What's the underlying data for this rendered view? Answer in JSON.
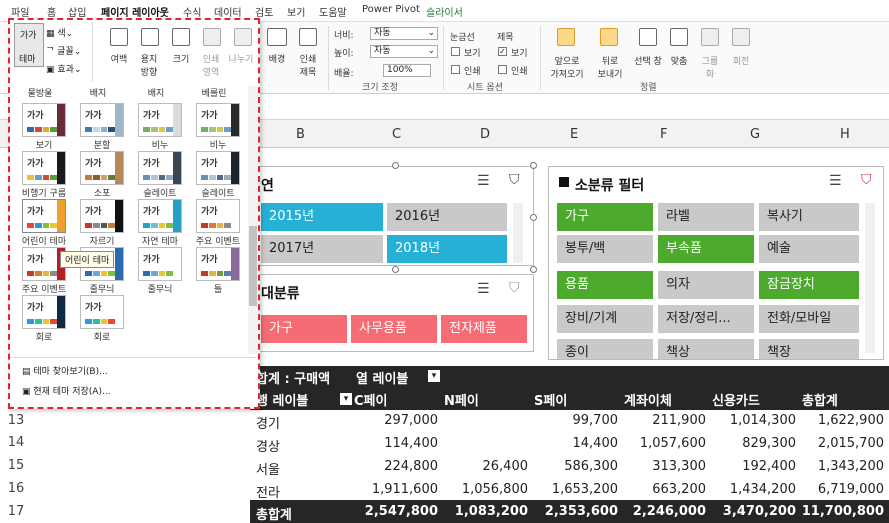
{
  "menu": [
    "파일",
    "홈",
    "삽입",
    "페이지 레이아웃",
    "수식",
    "데이터",
    "검토",
    "보기",
    "도움말",
    "Power Pivot",
    "슬라이서"
  ],
  "ribbon": {
    "theme_label": "테마",
    "colors_label": "색",
    "fonts_label": "글꼴",
    "effects_label": "효과",
    "margins_label": "여백",
    "orientation_label": "용지\n방향",
    "size_label": "크기",
    "print_area_label": "인쇄\n영역",
    "breaks_label": "나누기",
    "background_label": "배경",
    "print_titles_label": "인쇄\n제목",
    "width_label": "너비:",
    "width_value": "자동",
    "height_label": "높이:",
    "height_value": "자동",
    "scale_label": "배율:",
    "scale_value": "100%",
    "scale_group": "크기 조정",
    "gridlines_label": "눈금선",
    "headings_label": "제목",
    "view_label": "보기",
    "print_label": "인쇄",
    "sheet_options_group": "시트 옵션",
    "bring_forward": "앞으로\n가져오기",
    "send_backward": "뒤로\n보내기",
    "selection_pane": "선택 창",
    "align": "맞춤",
    "group": "그룹\n화",
    "rotate": "회전",
    "arrange_group": "정렬"
  },
  "gallery": {
    "row0_labels": [
      "물방울",
      "배지",
      "배지",
      "베를린"
    ],
    "themes": [
      {
        "label": "보기",
        "side": "#6b2b3a",
        "bars": [
          "#2e6aa8",
          "#d04a36",
          "#e8a92b",
          "#5c9b3b"
        ]
      },
      {
        "label": "분할",
        "side": "#9db7c9",
        "bars": [
          "#3f7ab4",
          "#c5d8e6",
          "#8fb0c4",
          "#2c4e6e"
        ]
      },
      {
        "label": "비누",
        "side": "#dcdcdc",
        "bars": [
          "#79a96b",
          "#a5c96a",
          "#d8c74f",
          "#6c9ec7"
        ]
      },
      {
        "label": "비누",
        "side": "#2b2b2b",
        "bars": [
          "#79a96b",
          "#a5c96a",
          "#d8c74f",
          "#6c9ec7"
        ]
      },
      {
        "label": "비행기 구름",
        "side": "#1a1a1a",
        "bars": [
          "#e9c23b",
          "#6c9ec7",
          "#d04a36",
          "#5c9b3b"
        ]
      },
      {
        "label": "소포",
        "side": "#b58a5a",
        "bars": [
          "#c77c34",
          "#8a5a2e",
          "#d0a35b",
          "#5e7c3b"
        ]
      },
      {
        "label": "슬레이트",
        "side": "#3a4652",
        "bars": [
          "#6b8fb4",
          "#b4c5d8",
          "#4e6a88",
          "#9aaabb"
        ]
      },
      {
        "label": "슬레이트",
        "side": "#1c232b",
        "bars": [
          "#6b8fb4",
          "#b4c5d8",
          "#4e6a88",
          "#9aaabb"
        ]
      },
      {
        "label": "어린이 테마",
        "side": "#f0a030",
        "bars": [
          "#e8482f",
          "#3a8fd3",
          "#7dc03c",
          "#f0c22f"
        ]
      },
      {
        "label": "자르기",
        "side": "#111",
        "bars": [
          "#c23b2a",
          "#8a8a8a",
          "#555",
          "#c77c34"
        ]
      },
      {
        "label": "자연 테마",
        "side": "#25a0c8",
        "bars": [
          "#25a0c8",
          "#6bc0d8",
          "#f0c22f",
          "#7dc03c"
        ]
      },
      {
        "label": "주요 이벤트",
        "side": "#ffffff",
        "bars": [
          "#c23b2a",
          "#d97b2a",
          "#e8b23b",
          "#8a8a8a"
        ]
      },
      {
        "label": "주요 이벤트",
        "side": "#b22222",
        "bars": [
          "#c23b2a",
          "#d97b2a",
          "#e8b23b",
          "#8a8a8a"
        ]
      },
      {
        "label": "줄무늬",
        "side": "#2a6bb0",
        "bars": [
          "#2a6bb0",
          "#6fa8d8",
          "#f0c22f",
          "#7dc03c"
        ]
      },
      {
        "label": "줄무늬",
        "side": "#ffffff",
        "bars": [
          "#2a6bb0",
          "#6fa8d8",
          "#f0c22f",
          "#7dc03c"
        ]
      },
      {
        "label": "틀",
        "side": "#8a6a9a",
        "bars": [
          "#c23b2a",
          "#e8b23b",
          "#7a9a3b",
          "#5a7aa8"
        ]
      },
      {
        "label": "회로",
        "side": "#0e2a44",
        "bars": [
          "#2a9ad8",
          "#28c0a0",
          "#f0c22f",
          "#e8482f"
        ]
      },
      {
        "label": "회로",
        "side": "#ffffff",
        "bars": [
          "#2a9ad8",
          "#28c0a0",
          "#f0c22f",
          "#e8482f"
        ]
      }
    ],
    "tooltip": "어린이 테마",
    "browse": "테마 찾아보기(B)...",
    "save": "현재 테마 저장(A)..."
  },
  "columns": [
    "B",
    "C",
    "D",
    "E",
    "F",
    "G",
    "H"
  ],
  "rows": [
    "13",
    "14",
    "15",
    "16",
    "17"
  ],
  "slicer_year": {
    "title": "연",
    "items": [
      "2015년",
      "2016년",
      "2017년",
      "2018년"
    ]
  },
  "slicer_major": {
    "title": "대분류",
    "items": [
      "가구",
      "사무용품",
      "전자제품"
    ]
  },
  "slicer_sub": {
    "title": "소분류 필터",
    "items": [
      "가구",
      "라벨",
      "복사기",
      "봉투/백",
      "부속품",
      "예술",
      "용품",
      "의자",
      "잠금장치",
      "장비/기계",
      "저장/정리...",
      "전화/모바일",
      "종이",
      "책상",
      "책장"
    ]
  },
  "pivot": {
    "header1": "합계 : 구매액",
    "col_labels": "열 레이블",
    "row_labels": "행 레이블",
    "headers": [
      "C페이",
      "N페이",
      "S페이",
      "계좌이체",
      "신용카드",
      "총합계"
    ],
    "data": [
      [
        "경기",
        "297,000",
        "",
        "99,700",
        "211,900",
        "1,014,300",
        "1,622,900"
      ],
      [
        "경상",
        "114,400",
        "",
        "14,400",
        "1,057,600",
        "829,300",
        "2,015,700"
      ],
      [
        "서울",
        "224,800",
        "26,400",
        "586,300",
        "313,300",
        "192,400",
        "1,343,200"
      ],
      [
        "전라",
        "1,911,600",
        "1,056,800",
        "1,653,200",
        "663,200",
        "1,434,200",
        "6,719,000"
      ]
    ],
    "total": [
      "총합계",
      "2,547,800",
      "1,083,200",
      "2,353,600",
      "2,246,000",
      "3,470,200",
      "11,700,800"
    ]
  },
  "colors": {
    "blue": "#27b0d6",
    "green": "#4caa2c",
    "red": "#f56c74",
    "gray": "#c9c9c9",
    "accent": "#1e7b34"
  }
}
